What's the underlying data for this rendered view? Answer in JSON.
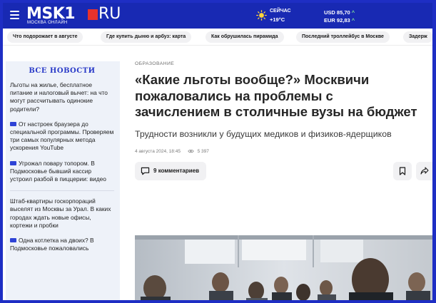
{
  "header": {
    "logo_main": "MSK1",
    "logo_ru": "RU",
    "logo_sub": "МОСКВА ОНЛАЙН",
    "weather_label": "СЕЙЧАС",
    "weather_temp": "+19°C",
    "usd": "USD 85,70",
    "eur": "EUR 92,83",
    "up_arrow": "^",
    "colors": {
      "brand": "#1829b3",
      "flag": "#e8322c",
      "rate_up": "#7fe09a"
    }
  },
  "trending": [
    "Что подорожает в августе",
    "Где купить дыню и арбуз: карта",
    "Как обрушилась пирамида",
    "Последний троллейбус в Москве",
    "Задерж"
  ],
  "sidebar": {
    "title": "ВСЕ НОВОСТИ",
    "items": [
      {
        "text": "Льготы на жилье, бесплатное питание и налоговый вычет: на что могут рассчитывать одинокие родители?",
        "video": false
      },
      {
        "text": "От настроек браузера до специальной программы. Проверяем три самых популярных метода ускорения YouTube",
        "video": true
      },
      {
        "text": "Угрожал повару топором. В Подмосковье бывший кассир устроил разбой в пиццерии: видео",
        "video": true
      },
      {
        "text": "Штаб-квартиры госкорпораций выселят из Москвы за Урал. В каких городах ждать новые офисы, кортежи и пробки",
        "video": false
      },
      {
        "text": "Одна котлетка на двоих? В Подмосковье пожаловались",
        "video": true
      }
    ]
  },
  "article": {
    "category": "ОБРАЗОВАНИЕ",
    "headline": "«Какие льготы вообще?» Москвичи пожаловались на проблемы с зачислением в столичные вузы на бюджет",
    "lede": "Трудности возникли у будущих медиков и физиков-ядерщиков",
    "date": "4 августа 2024, 18:45",
    "views": "5 397",
    "comments_count": "9",
    "comments_label": "комментариев"
  },
  "icons": {
    "menu": "menu-icon",
    "weather": "sun-icon",
    "views": "eye-icon",
    "comments": "chat-bubble-icon",
    "bookmark": "bookmark-icon",
    "share": "share-icon",
    "video": "video-camera-icon"
  }
}
